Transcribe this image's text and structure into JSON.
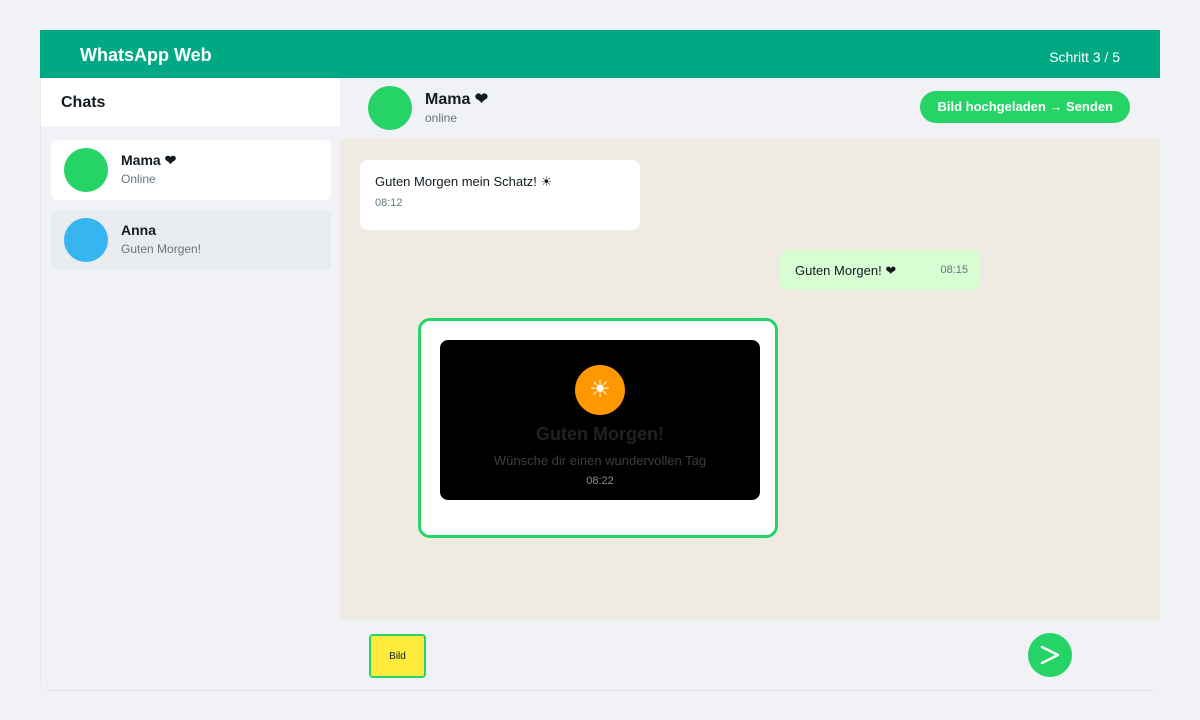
{
  "app": {
    "title": "WhatsApp Web",
    "step": "Schritt 3 / 5",
    "accent": "#00a884"
  },
  "sidebar": {
    "title": "Chats",
    "chats": [
      {
        "name": "Mama ❤",
        "subtitle": "Online",
        "avatar_color": "#25d366",
        "active": true
      },
      {
        "name": "Anna",
        "subtitle": "Guten Morgen!",
        "avatar_color": "#36b5f0",
        "active": false
      }
    ]
  },
  "chat": {
    "name": "Mama ❤",
    "status": "online",
    "action_label": "Bild hochgeladen → Senden",
    "messages": [
      {
        "direction": "incoming",
        "text": "Guten Morgen mein Schatz! ☀",
        "time": "08:12"
      },
      {
        "direction": "outgoing",
        "text": "Guten Morgen! ❤",
        "time": "08:15"
      }
    ],
    "image_message": {
      "icon": "sun-icon",
      "headline": "Guten Morgen!",
      "subline": "Wünsche dir einen wundervollen Tag",
      "time": "08:22"
    }
  },
  "composer": {
    "attach_label": "Bild",
    "send_icon": "send-icon"
  }
}
